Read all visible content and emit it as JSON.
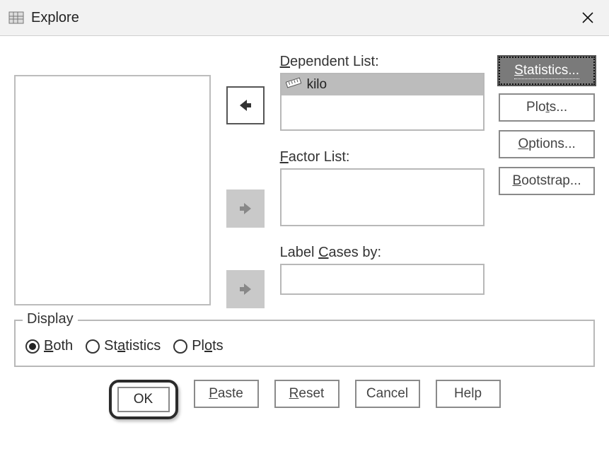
{
  "window": {
    "title": "Explore"
  },
  "lists": {
    "dependent": {
      "label_pre": "D",
      "label_post": "ependent List:",
      "items": [
        {
          "name": "kilo"
        }
      ]
    },
    "factor": {
      "label_pre": "F",
      "label_post": "actor List:"
    },
    "labelcases": {
      "label_pre": "Label ",
      "label_u": "C",
      "label_post": "ases by:"
    }
  },
  "side": {
    "statistics": {
      "u": "S",
      "rest": "tatistics..."
    },
    "plots": {
      "pre": "Plo",
      "u": "t",
      "post": "s..."
    },
    "options": {
      "u": "O",
      "rest": "ptions..."
    },
    "bootstrap": {
      "u": "B",
      "rest": "ootstrap..."
    }
  },
  "display": {
    "legend": "Display",
    "both": {
      "u": "B",
      "rest": "oth"
    },
    "statistics": {
      "pre": "St",
      "u": "a",
      "post": "tistics"
    },
    "plots": {
      "pre": "Pl",
      "u": "o",
      "post": "ts"
    },
    "selected": "both"
  },
  "buttons": {
    "ok": "OK",
    "paste": {
      "u": "P",
      "rest": "aste"
    },
    "reset": {
      "u": "R",
      "rest": "eset"
    },
    "cancel": "Cancel",
    "help": "Help"
  }
}
